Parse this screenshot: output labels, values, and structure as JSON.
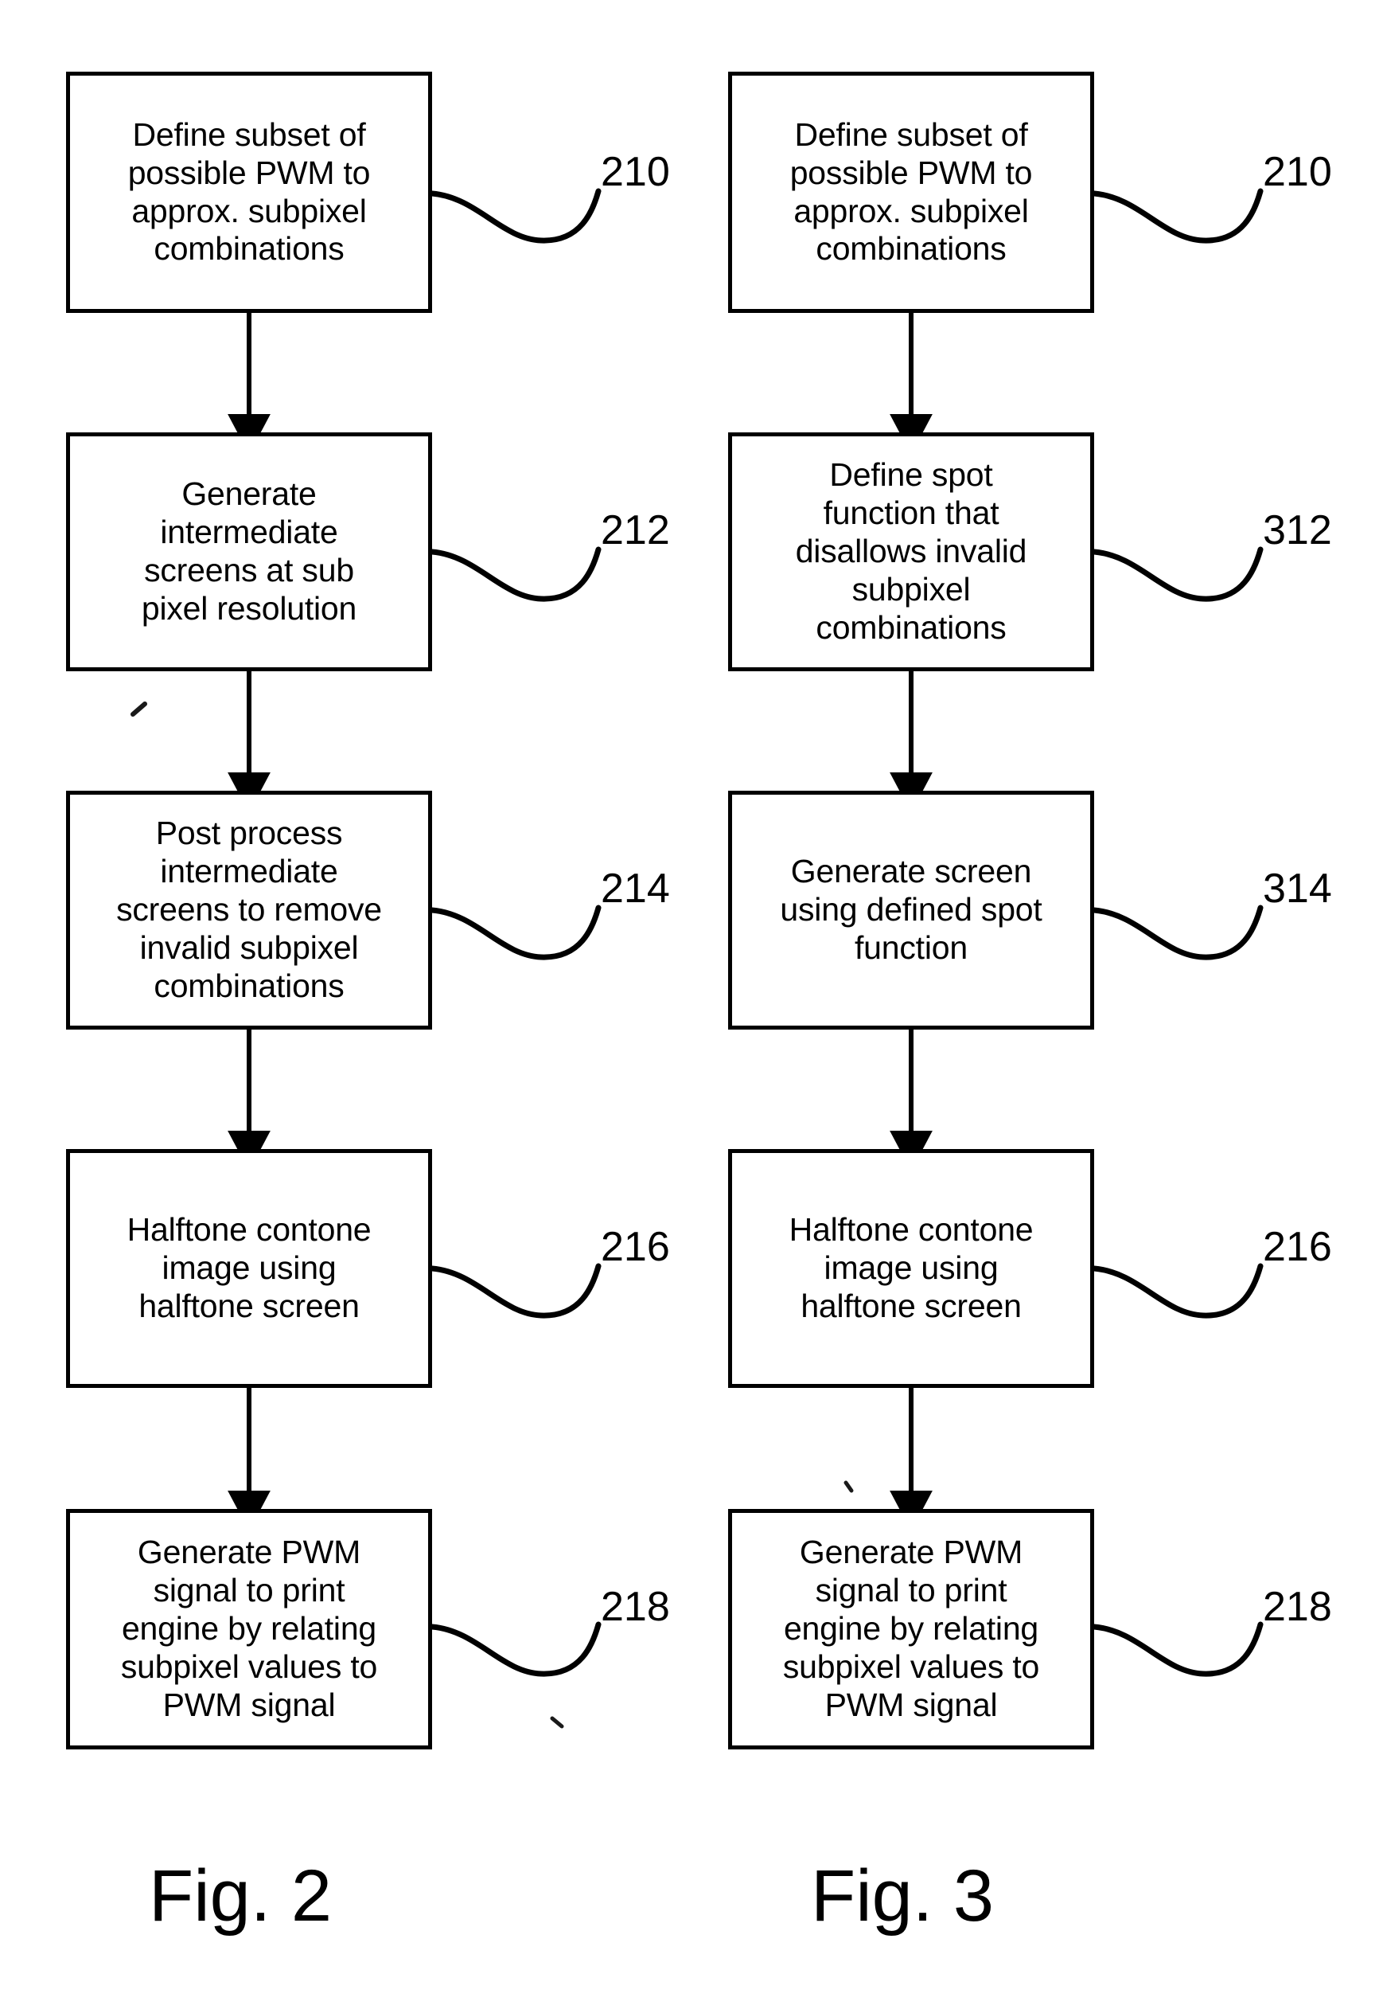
{
  "sheet": {
    "background_color": "#ffffff",
    "ink_color": "#000000"
  },
  "figures": [
    {
      "id": "fig-2",
      "caption": "Fig. 2",
      "steps": [
        {
          "ref": "210",
          "text": "Define subset of\npossible PWM to\napprox. subpixel\ncombinations"
        },
        {
          "ref": "212",
          "text": "Generate\nintermediate\nscreens at sub\npixel resolution"
        },
        {
          "ref": "214",
          "text": "Post process\nintermediate\nscreens to remove\ninvalid subpixel\ncombinations"
        },
        {
          "ref": "216",
          "text": "Halftone contone\nimage using\nhalftone screen"
        },
        {
          "ref": "218",
          "text": "Generate PWM\nsignal to print\nengine by relating\nsubpixel values to\nPWM signal"
        }
      ]
    },
    {
      "id": "fig-3",
      "caption": "Fig. 3",
      "steps": [
        {
          "ref": "210",
          "text": "Define subset of\npossible PWM to\napprox. subpixel\ncombinations"
        },
        {
          "ref": "312",
          "text": "Define spot\nfunction that\ndisallows invalid\nsubpixel\ncombinations"
        },
        {
          "ref": "314",
          "text": "Generate screen\nusing defined spot\nfunction"
        },
        {
          "ref": "216",
          "text": "Halftone contone\nimage using\nhalftone screen"
        },
        {
          "ref": "218",
          "text": "Generate PWM\nsignal to print\nengine by relating\nsubpixel values to\nPWM signal"
        }
      ]
    }
  ]
}
